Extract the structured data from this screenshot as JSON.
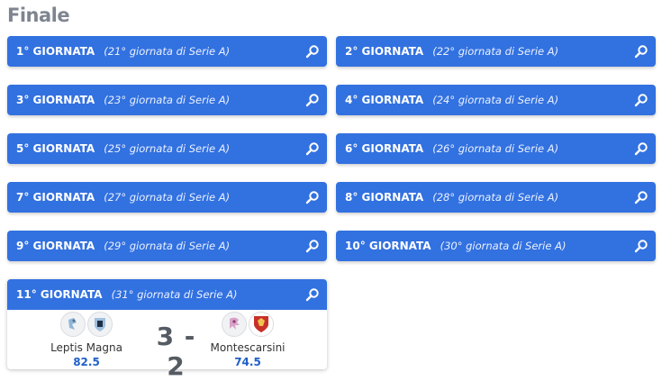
{
  "section": {
    "title": "Finale"
  },
  "rounds": [
    {
      "name": "1° GIORNATA",
      "sub": "(21° giornata di Serie A)"
    },
    {
      "name": "2° GIORNATA",
      "sub": "(22° giornata di Serie A)"
    },
    {
      "name": "3° GIORNATA",
      "sub": "(23° giornata di Serie A)"
    },
    {
      "name": "4° GIORNATA",
      "sub": "(24° giornata di Serie A)"
    },
    {
      "name": "5° GIORNATA",
      "sub": "(25° giornata di Serie A)"
    },
    {
      "name": "6° GIORNATA",
      "sub": "(26° giornata di Serie A)"
    },
    {
      "name": "7° GIORNATA",
      "sub": "(27° giornata di Serie A)"
    },
    {
      "name": "8° GIORNATA",
      "sub": "(28° giornata di Serie A)"
    },
    {
      "name": "9° GIORNATA",
      "sub": "(29° giornata di Serie A)"
    },
    {
      "name": "10° GIORNATA",
      "sub": "(30° giornata di Serie A)"
    },
    {
      "name": "11° GIORNATA",
      "sub": "(31° giornata di Serie A)"
    }
  ],
  "match": {
    "home": {
      "name": "Leptis Magna",
      "score": "82.5"
    },
    "away": {
      "name": "Montescarsini",
      "score": "74.5"
    },
    "result": "3 - 2"
  },
  "icons": {
    "search": "search-icon"
  },
  "colors": {
    "accent": "#3271e0",
    "title": "#7e8590",
    "points": "#1f5fc7"
  }
}
